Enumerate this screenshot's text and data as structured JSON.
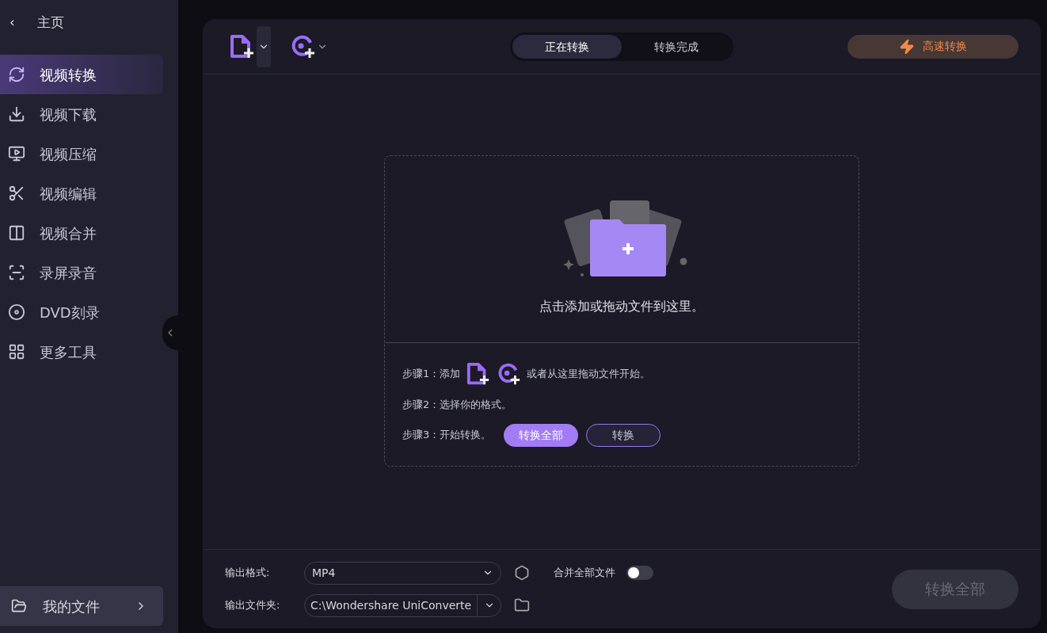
{
  "sidebar": {
    "back": {
      "icon": "‹",
      "label": "主页"
    },
    "items": [
      {
        "kind": "convert",
        "label": "视频转换",
        "selected": true
      },
      {
        "kind": "download",
        "label": "视频下载",
        "selected": false
      },
      {
        "kind": "compress",
        "label": "视频压缩",
        "selected": false
      },
      {
        "kind": "edit",
        "label": "视频编辑",
        "selected": false
      },
      {
        "kind": "merge",
        "label": "视频合并",
        "selected": false
      },
      {
        "kind": "record",
        "label": "录屏录音",
        "selected": false
      },
      {
        "kind": "dvd",
        "label": "DVD刻录",
        "selected": false
      },
      {
        "kind": "tools",
        "label": "更多工具",
        "selected": false
      }
    ],
    "my_files": {
      "label": "我的文件"
    }
  },
  "tabs": [
    {
      "label": "正在转换",
      "selected": true
    },
    {
      "label": "转换完成",
      "selected": false
    }
  ],
  "speed_button": {
    "label": "高速转换"
  },
  "drop_zone": {
    "prompt": "点击添加或拖动文件到这里。",
    "steps": [
      {
        "kind": "add",
        "label": "步骤1：添加",
        "suffix": "或者从这里拖动文件开始。"
      },
      {
        "kind": "text",
        "label": "步骤2：选择你的格式。"
      },
      {
        "kind": "buttons",
        "label": "步骤3：开始转换。",
        "primary": "转换全部",
        "secondary": "转换"
      }
    ]
  },
  "bottom": {
    "format_label": "输出格式:",
    "format_value": "MP4",
    "folder_label": "输出文件夹:",
    "folder_value": "C:\\Wondershare UniConverte",
    "merge_label": "合并全部文件",
    "merge_on": false,
    "convert_all": {
      "label": "转换全部",
      "disabled": true
    }
  }
}
